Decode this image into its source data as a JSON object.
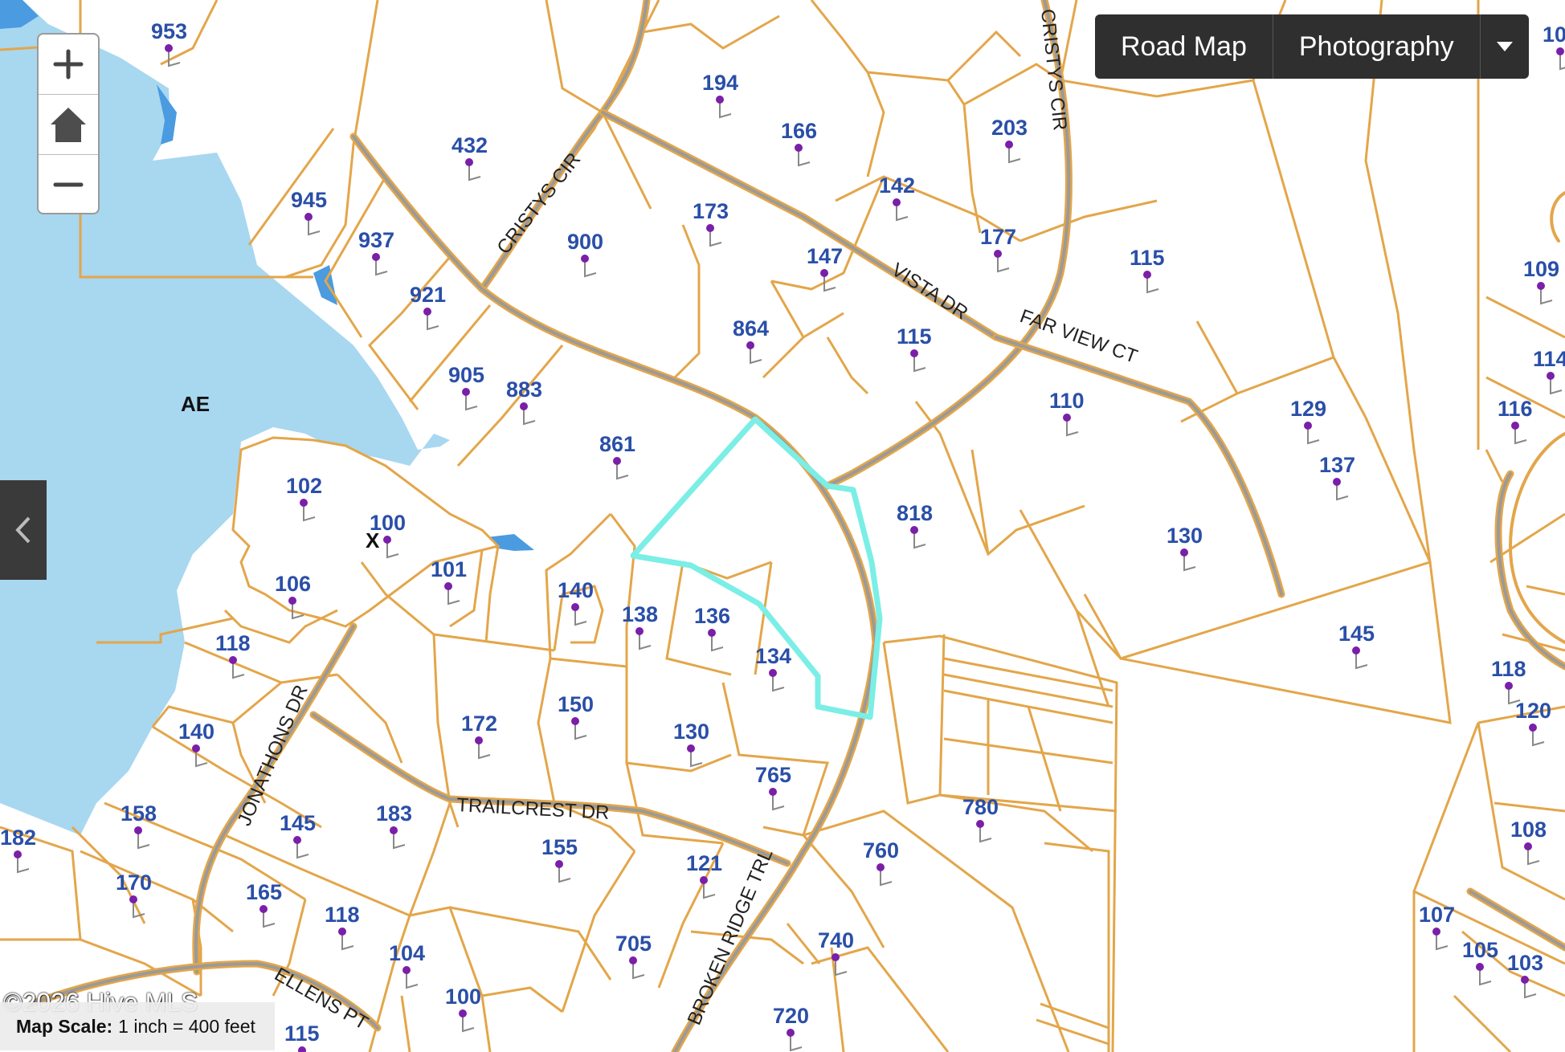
{
  "controls": {
    "zoom_in": "+",
    "home": "home",
    "zoom_out": "−",
    "basemap_road": "Road Map",
    "basemap_photo": "Photography"
  },
  "footer": {
    "copyright": "©2026 Hive MLS",
    "scale_label": "Map Scale:",
    "scale_value": "1 inch = 400 feet"
  },
  "zones": {
    "flood_zone": "AE",
    "other_zone": "X"
  },
  "streets": {
    "cristys_cir_a": "CRISTYS CIR",
    "cristys_cir_b": "CRISTYS CIR",
    "vista_dr": "VISTA DR",
    "far_view_ct": "FAR VIEW CT",
    "jonathons_dr": "JONATHONS DR",
    "trailcrest_dr": "TRAILCREST DR",
    "broken_ridge_trl": "BROKEN RIDGE TRL",
    "ellens_pt": "ELLENS PT"
  },
  "parcels": {
    "p953": "953",
    "p432": "432",
    "p945": "945",
    "p937": "937",
    "p921": "921",
    "p905": "905",
    "p883": "883",
    "p900": "900",
    "p194": "194",
    "p166": "166",
    "p173": "173",
    "p142": "142",
    "p203": "203",
    "p177": "177",
    "p147": "147",
    "p864": "864",
    "p115a": "115",
    "p115b": "115",
    "p110": "110",
    "p861": "861",
    "p129": "129",
    "p137": "137",
    "p102": "102",
    "p100a": "100",
    "p101": "101",
    "p106": "106",
    "p118a": "118",
    "p140a": "140",
    "p138": "138",
    "p136": "136",
    "p134": "134",
    "p818": "818",
    "p130a": "130",
    "p145a": "145",
    "p150": "150",
    "p172": "172",
    "p130b": "130",
    "p765": "765",
    "p140b": "140",
    "p158": "158",
    "p182": "182",
    "p145b": "145",
    "p183": "183",
    "p155": "155",
    "p121": "121",
    "p780": "780",
    "p760": "760",
    "p170": "170",
    "p165": "165",
    "p118b": "118",
    "p104": "104",
    "p705": "705",
    "p740": "740",
    "p100b": "100",
    "p720": "720",
    "p115c": "115",
    "p109": "109",
    "p114": "114",
    "p116": "116",
    "p118c": "118",
    "p120": "120",
    "p108": "108",
    "p107": "107",
    "p105": "105",
    "p103": "103",
    "p10x": "10"
  }
}
